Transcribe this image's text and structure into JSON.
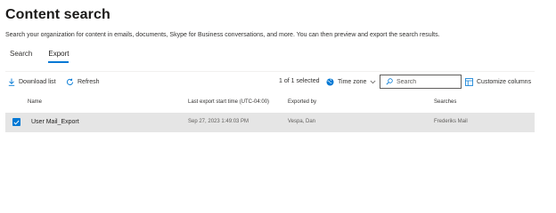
{
  "page": {
    "title": "Content search",
    "description": "Search your organization for content in emails, documents, Skype for Business conversations, and more. You can then preview and export the search results."
  },
  "tabs": [
    {
      "label": "Search",
      "active": false
    },
    {
      "label": "Export",
      "active": true
    }
  ],
  "toolbar": {
    "download_label": "Download list",
    "refresh_label": "Refresh",
    "selected_count": "1 of 1 selected",
    "timezone_label": "Time zone",
    "search_placeholder": "Search",
    "customize_label": "Customize columns"
  },
  "table": {
    "columns": [
      "Name",
      "Last export start time (UTC-04:00)",
      "Exported by",
      "Searches"
    ],
    "rows": [
      {
        "selected": true,
        "name": "User Mail_Export",
        "last_export": "Sep 27, 2023 1:49:03 PM",
        "exported_by": "Vespa, Dan",
        "searches": "Frederiks Mail"
      }
    ]
  },
  "colors": {
    "accent": "#0078d4",
    "selected_row_bg": "#e5e5e5",
    "text": "#323130"
  },
  "icons": {
    "download": "download-icon",
    "refresh": "refresh-icon",
    "timezone": "globe-icon",
    "search": "search-icon",
    "customize": "columns-icon",
    "checkbox": "checkmark-icon"
  }
}
